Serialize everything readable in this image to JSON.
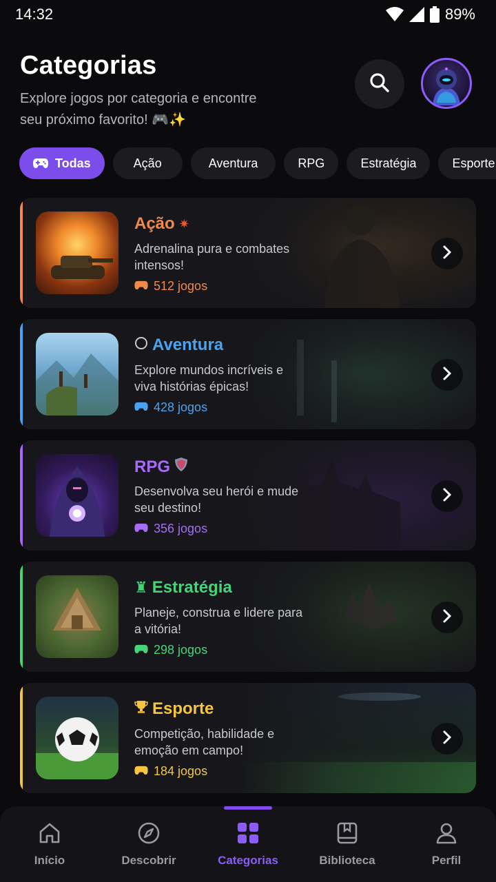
{
  "status": {
    "time": "14:32",
    "battery": "89%"
  },
  "header": {
    "title": "Categorias",
    "subtitle": "Explore jogos por categoria e encontre seu próximo favorito! 🎮✨"
  },
  "chips": [
    {
      "label": "Todas",
      "active": true
    },
    {
      "label": "Ação"
    },
    {
      "label": "Aventura"
    },
    {
      "label": "RPG"
    },
    {
      "label": "Estratégia"
    },
    {
      "label": "Esporte"
    }
  ],
  "categories": [
    {
      "title": "Ação",
      "title_icon": "explosion-icon",
      "description": "Adrenalina pura e combates intensos!",
      "count": "512 jogos",
      "color": "#f08a4b"
    },
    {
      "title": "Aventura",
      "title_icon": "compass-icon",
      "description": "Explore mundos incríveis e viva histórias épicas!",
      "count": "428 jogos",
      "color": "#4aa3f0"
    },
    {
      "title": "RPG",
      "title_icon": "shield-icon",
      "description": "Desenvolva seu herói e mude seu destino!",
      "count": "356 jogos",
      "color": "#a56cf5"
    },
    {
      "title": "Estratégia",
      "title_icon": "chess-rook-icon",
      "description": "Planeje, construa e lidere para a vitória!",
      "count": "298 jogos",
      "color": "#45d47a"
    },
    {
      "title": "Esporte",
      "title_icon": "trophy-icon",
      "description": "Competição, habilidade e emoção em campo!",
      "count": "184 jogos",
      "color": "#f5c542"
    }
  ],
  "nav": [
    {
      "label": "Início",
      "icon": "home-icon"
    },
    {
      "label": "Descobrir",
      "icon": "compass-icon"
    },
    {
      "label": "Categorias",
      "icon": "grid-icon",
      "active": true
    },
    {
      "label": "Biblioteca",
      "icon": "library-icon"
    },
    {
      "label": "Perfil",
      "icon": "user-icon"
    }
  ],
  "colors": {
    "accent": "#7c4dea",
    "background": "#0b0b0e",
    "card": "#17171b"
  }
}
